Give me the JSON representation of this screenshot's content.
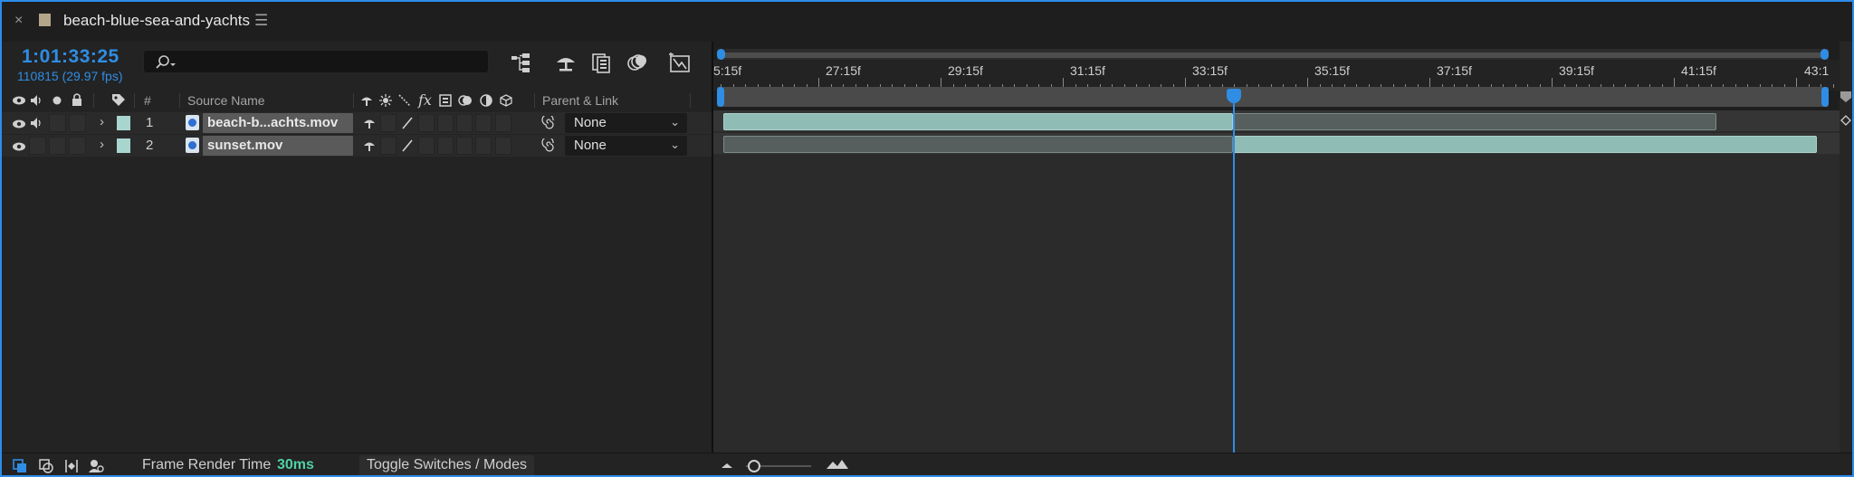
{
  "tab": {
    "close_glyph": "×",
    "title": "beach-blue-sea-and-yachts",
    "menu_glyph": "☰",
    "swatch_color": "#b3a58a"
  },
  "composition": {
    "timecode": "1:01:33:25",
    "fps_info": "110815 (29.97 fps)",
    "search_placeholder": ""
  },
  "columns": {
    "label_tag": "",
    "number": "#",
    "source_name": "Source Name",
    "parent_link": "Parent & Link"
  },
  "layers": [
    {
      "number": "1",
      "name": "beach-b...achts.mov",
      "parent": "None",
      "label_color": "#a8d6cf"
    },
    {
      "number": "2",
      "name": "sunset.mov",
      "parent": "None",
      "label_color": "#a8d6cf"
    }
  ],
  "ruler": {
    "ticks": [
      "5:15f",
      "27:15f",
      "29:15f",
      "31:15f",
      "33:15f",
      "35:15f",
      "37:15f",
      "39:15f",
      "41:15f",
      "43:1"
    ]
  },
  "footer": {
    "frame_render_label": "Frame Render Time",
    "frame_render_value": "30ms",
    "toggle_label": "Toggle Switches / Modes"
  },
  "colors": {
    "accent": "#2f8de4",
    "clip": "#8fbcb5",
    "render_value": "#4fd1a8"
  },
  "icons": [
    "eye-icon",
    "audio-icon",
    "solo-icon",
    "lock-icon",
    "label-icon",
    "shy-icon",
    "collapse-icon",
    "quality-icon",
    "effects-icon",
    "frame-blend-icon",
    "motion-blur-icon",
    "adjustment-icon",
    "3d-icon",
    "pickwhip-icon",
    "search-icon",
    "comp-flowchart-icon",
    "shy-layers-icon",
    "frame-blending-icon",
    "motion-blur-toggle-icon",
    "graph-editor-icon",
    "zoom-out-icon",
    "zoom-in-icon"
  ]
}
